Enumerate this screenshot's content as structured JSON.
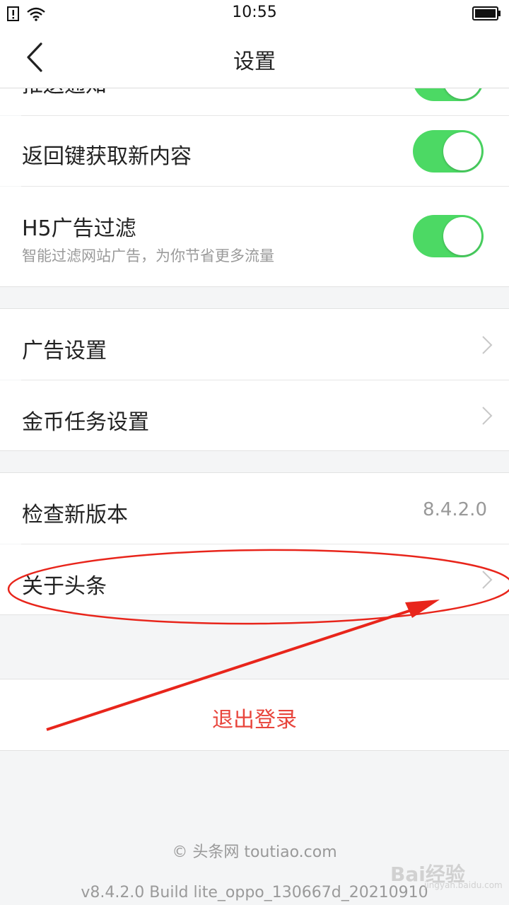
{
  "status_bar": {
    "time": "10:55"
  },
  "header": {
    "title": "设置"
  },
  "settings": {
    "partial_label": "推送通知",
    "back_key_label": "返回键获取新内容",
    "h5_label": "H5广告过滤",
    "h5_sub": "智能过滤网站广告，为你节省更多流量",
    "ad_settings": "广告设置",
    "coin_settings": "金币任务设置",
    "check_version": "检查新版本",
    "version_value": "8.4.2.0",
    "about": "关于头条"
  },
  "toggles": {
    "push": true,
    "back_key": true,
    "h5_filter": true
  },
  "logout_label": "退出登录",
  "footer": {
    "copyright": "© 头条网 toutiao.com",
    "build": "v8.4.2.0 Build lite_oppo_130667d_20210910"
  },
  "watermark": {
    "text": "Bai经验",
    "sub": "jingyan.baidu.com"
  },
  "colors": {
    "toggle_on": "#4cd964",
    "logout": "#e8453c",
    "annotation": "#e8251b"
  }
}
